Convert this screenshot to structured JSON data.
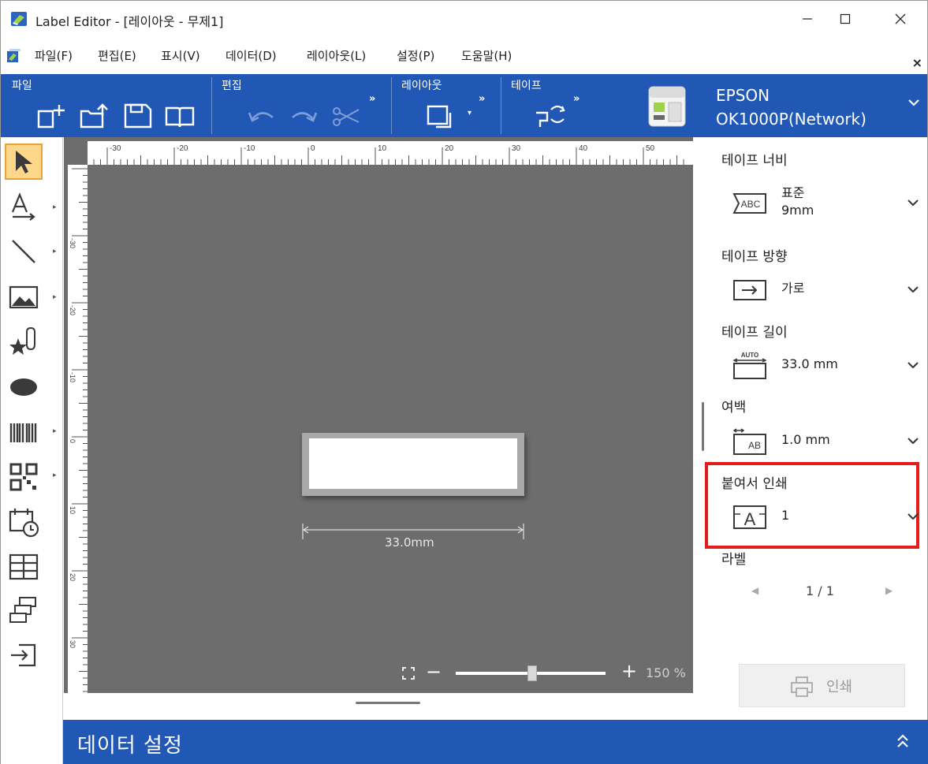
{
  "window": {
    "title": "Label Editor - [레이아웃  - 무제1]"
  },
  "menu": {
    "items": [
      "파일(F)",
      "편집(E)",
      "표시(V)",
      "데이터(D)",
      "레이아웃(L)",
      "설정(P)",
      "도움말(H)"
    ],
    "close_glyph": "×"
  },
  "ribbon": {
    "groups": {
      "file": "파일",
      "edit": "편집",
      "layout": "레이아웃",
      "tape": "테이프"
    },
    "more_glyph": "»",
    "printer_line1": "EPSON",
    "printer_line2": "OK1000P(Network)"
  },
  "toolbox": {
    "more_glyph": "▸"
  },
  "canvas": {
    "ruler_top_labels": [
      "-30",
      "-20",
      "-10",
      "0",
      "10",
      "20",
      "30",
      "40",
      "50"
    ],
    "ruler_left_labels": [
      "-30",
      "-20",
      "-10",
      "0",
      "10",
      "20",
      "30",
      "40"
    ],
    "dimension_text": "33.0mm",
    "zoom_level": "150 %",
    "zoom_minus": "−",
    "zoom_plus": "+",
    "zoom_fraction": 0.48
  },
  "properties": {
    "tape_width": {
      "title": "테이프 너비",
      "value_line1": "표준",
      "value_line2": "9mm",
      "icon_text": "ABC"
    },
    "tape_direction": {
      "title": "테이프 방향",
      "value": "가로"
    },
    "tape_length": {
      "title": "테이프 길이",
      "value": "33.0 mm",
      "icon_text": "AUTO"
    },
    "margin": {
      "title": "여백",
      "value": "1.0 mm",
      "icon_text": "AB"
    },
    "continuous_print": {
      "title": "붙여서 인쇄",
      "value": "1",
      "icon_text": "A"
    },
    "label": {
      "title": "라벨",
      "page": "1 / 1",
      "prev": "◀",
      "next": "▶"
    },
    "print_button": "인쇄"
  },
  "databar": {
    "title": "데이터 설정"
  },
  "colors": {
    "ribbon_blue": "#2158b6",
    "highlight_red": "#e41c1c",
    "canvas_gray": "#6d6d6d"
  }
}
